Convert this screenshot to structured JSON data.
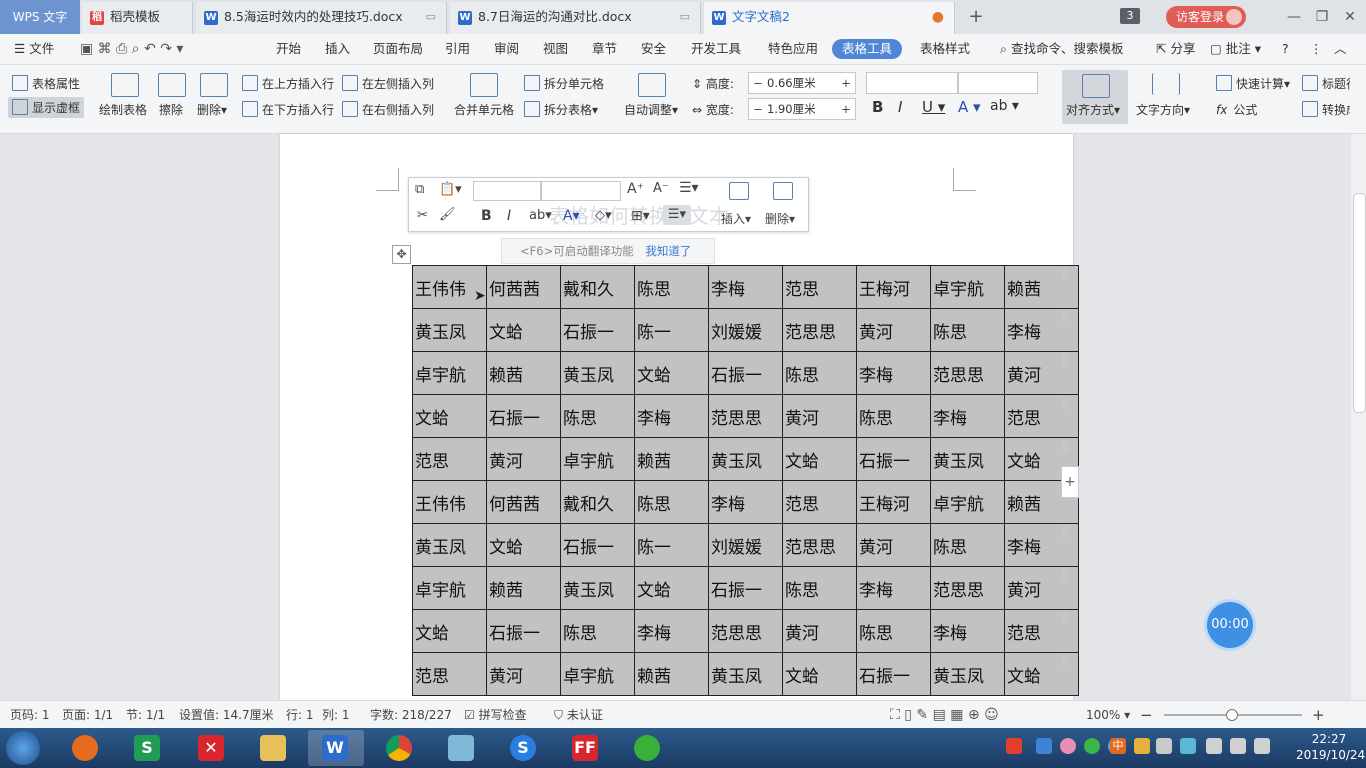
{
  "titlebar": {
    "app_name": "WPS 文字",
    "tabs": [
      {
        "label": "稻壳模板",
        "icon": "daoke-icon"
      },
      {
        "label": "8.5海运时效内的处理技巧.docx",
        "icon": "wps-doc-icon"
      },
      {
        "label": "8.7日海运的沟通对比.docx",
        "icon": "wps-doc-icon"
      },
      {
        "label": "文字文稿2",
        "icon": "wps-doc-icon"
      }
    ],
    "new_tab": "+",
    "badge_count": "3",
    "login_label": "访客登录"
  },
  "menubar": {
    "file_label": "文件",
    "items": [
      "开始",
      "插入",
      "页面布局",
      "引用",
      "审阅",
      "视图",
      "章节",
      "安全",
      "开发工具",
      "特色应用",
      "表格工具",
      "表格样式"
    ],
    "active_item": "表格工具",
    "search_label": "查找命令、搜索模板",
    "share_label": "分享",
    "comment_label": "批注"
  },
  "toolbar": {
    "table_props": "表格属性",
    "show_gridlines": "显示虚框",
    "draw_table": "绘制表格",
    "erase": "擦除",
    "delete": "删除",
    "insert_above": "在上方插入行",
    "insert_below": "在下方插入行",
    "insert_left": "在左侧插入列",
    "insert_right": "在右侧插入列",
    "merge_cells": "合并单元格",
    "split_cells": "拆分单元格",
    "split_table": "拆分表格",
    "auto_fit": "自动调整",
    "height_label": "高度:",
    "height_value": "0.66厘米",
    "width_label": "宽度:",
    "width_value": "1.90厘米",
    "align": "对齐方式",
    "text_direction": "文字方向",
    "quick_calc": "快速计算",
    "formula": "公式",
    "title_row": "标题行",
    "convert": "转换成"
  },
  "minitoolbar": {
    "insert_label": "插入",
    "delete_label": "删除",
    "ghost_text": "表格如何转换为文本"
  },
  "hint": {
    "text": "<F6>可启动翻译功能",
    "ok_label": "我知道了"
  },
  "table": {
    "rows": [
      [
        "王伟伟",
        "何茜茜",
        "戴和久",
        "陈思",
        "李梅",
        "范思",
        "王梅河",
        "卓宇航",
        "赖茜"
      ],
      [
        "黄玉凤",
        "文蛤",
        "石振一",
        "陈一",
        "刘媛媛",
        "范思思",
        "黄河",
        "陈思",
        "李梅"
      ],
      [
        "卓宇航",
        "赖茜",
        "黄玉凤",
        "文蛤",
        "石振一",
        "陈思",
        "李梅",
        "范思思",
        "黄河"
      ],
      [
        "文蛤",
        "石振一",
        "陈思",
        "李梅",
        "范思思",
        "黄河",
        "陈思",
        "李梅",
        "范思"
      ],
      [
        "范思",
        "黄河",
        "卓宇航",
        "赖茜",
        "黄玉凤",
        "文蛤",
        "石振一",
        "黄玉凤",
        "文蛤"
      ],
      [
        "王伟伟",
        "何茜茜",
        "戴和久",
        "陈思",
        "李梅",
        "范思",
        "王梅河",
        "卓宇航",
        "赖茜"
      ],
      [
        "黄玉凤",
        "文蛤",
        "石振一",
        "陈一",
        "刘媛媛",
        "范思思",
        "黄河",
        "陈思",
        "李梅"
      ],
      [
        "卓宇航",
        "赖茜",
        "黄玉凤",
        "文蛤",
        "石振一",
        "陈思",
        "李梅",
        "范思思",
        "黄河"
      ],
      [
        "文蛤",
        "石振一",
        "陈思",
        "李梅",
        "范思思",
        "黄河",
        "陈思",
        "李梅",
        "范思"
      ],
      [
        "范思",
        "黄河",
        "卓宇航",
        "赖茜",
        "黄玉凤",
        "文蛤",
        "石振一",
        "黄玉凤",
        "文蛤"
      ]
    ]
  },
  "timer": "00:00",
  "statusbar": {
    "page_num": "页码: 1",
    "page": "页面: 1/1",
    "section": "节: 1/1",
    "setting": "设置值: 14.7厘米",
    "row": "行: 1",
    "col": "列: 1",
    "word_count": "字数: 218/227",
    "spell_check": "拼写检查",
    "auth": "未认证",
    "zoom": "100%"
  },
  "taskbar": {
    "time": "22:27",
    "date": "2019/10/24",
    "ime_label": "中"
  },
  "colors": {
    "accent": "#4f86d6",
    "table_fill": "#c2c2c2",
    "timer": "#3f8fe3",
    "login": "#e05d55"
  }
}
